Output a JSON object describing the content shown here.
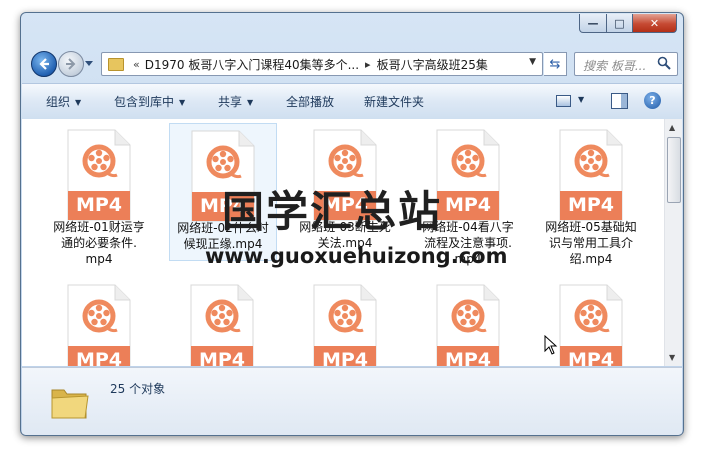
{
  "window": {
    "controls": {
      "minimize": "—",
      "maximize": "□",
      "close": "✕"
    }
  },
  "navigation": {
    "breadcrumb_prefix": "«",
    "path": [
      "D1970 板哥八字入门课程40集等多个...",
      "板哥八字高级班25集"
    ],
    "search_placeholder": "搜索 板哥..."
  },
  "toolbar": {
    "items": [
      {
        "label": "组织",
        "dropdown": true
      },
      {
        "label": "包含到库中",
        "dropdown": true
      },
      {
        "label": "共享",
        "dropdown": true
      },
      {
        "label": "全部播放",
        "dropdown": false
      },
      {
        "label": "新建文件夹",
        "dropdown": false
      }
    ]
  },
  "files": [
    {
      "name": "网络班-01财运亨通的必要条件.mp4",
      "badge": "MP4",
      "lines": [
        "网络班-01财运亨",
        "通的必要条件.",
        "mp4"
      ]
    },
    {
      "name": "网络班-02什么时候现正缘.mp4",
      "badge": "MP4",
      "lines": [
        "网络班-02什么时",
        "候现正缘.mp4"
      ]
    },
    {
      "name": "网络班-03断生死关法.mp4",
      "badge": "MP4",
      "lines": [
        "网络班-03断生死",
        "关法.mp4"
      ]
    },
    {
      "name": "网络班-04看八字流程及注意事项.mp4",
      "badge": "MP4",
      "lines": [
        "网络班-04看八字",
        "流程及注意事项.",
        "mp4"
      ]
    },
    {
      "name": "网络班-05基础知识与常用工具介绍.mp4",
      "badge": "MP4",
      "lines": [
        "网络班-05基础知",
        "识与常用工具介",
        "绍.mp4"
      ]
    },
    {
      "name": "",
      "badge": "MP4",
      "lines": []
    },
    {
      "name": "",
      "badge": "MP4",
      "lines": []
    },
    {
      "name": "",
      "badge": "MP4",
      "lines": []
    },
    {
      "name": "",
      "badge": "MP4",
      "lines": []
    },
    {
      "name": "",
      "badge": "MP4",
      "lines": []
    }
  ],
  "status": {
    "count_text": "25 个对象"
  },
  "watermark": {
    "title": "国学汇总站",
    "url": "www.guoxuehuizong.com"
  },
  "colors": {
    "accent_orange": "#ef8a5e",
    "badge_orange": "#ec7f58",
    "toolbar_text": "#1e395b"
  }
}
